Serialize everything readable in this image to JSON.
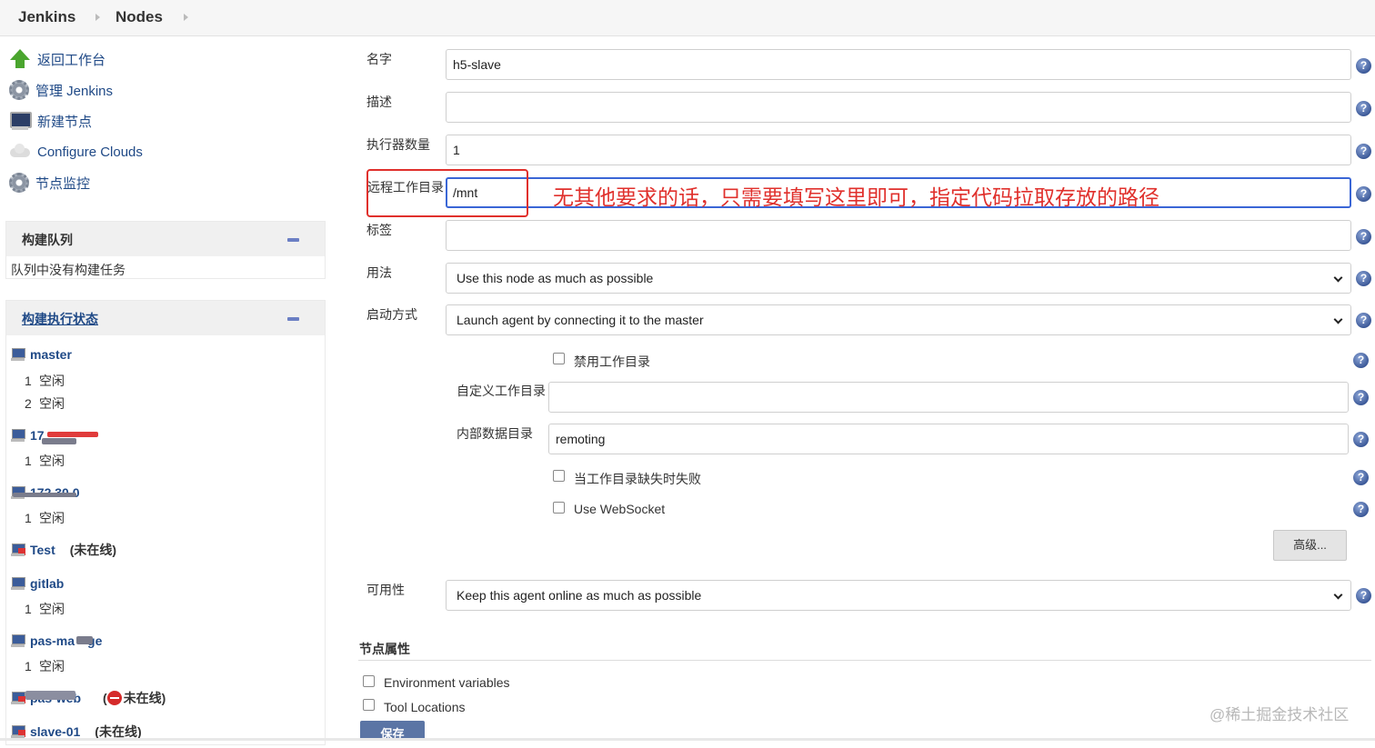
{
  "breadcrumb": {
    "jenkins": "Jenkins",
    "nodes": "Nodes"
  },
  "sidebar": {
    "tasks": [
      {
        "label": "返回工作台",
        "icon": "up-arrow-icon"
      },
      {
        "label": "管理 Jenkins",
        "icon": "gear-icon"
      },
      {
        "label": "新建节点",
        "icon": "computer-icon"
      },
      {
        "label": "Configure Clouds",
        "icon": "cloud-icon"
      },
      {
        "label": "节点监控",
        "icon": "gear-icon"
      }
    ],
    "build_queue": {
      "title": "构建队列",
      "empty_text": "队列中没有构建任务"
    },
    "executor_status": {
      "title": "构建执行状态",
      "idle": "空闲",
      "nodes": [
        {
          "name": "master",
          "executors": [
            "1",
            "2"
          ]
        },
        {
          "name": "17",
          "executors": [
            "1"
          ]
        },
        {
          "name": "172.30.0",
          "executors": [
            "1"
          ]
        },
        {
          "name": "Test",
          "status": "(未在线)"
        },
        {
          "name": "gitlab",
          "executors": [
            "1"
          ]
        },
        {
          "name": "pas-ma",
          "name_tail": "ge",
          "executors": [
            "1"
          ]
        },
        {
          "name": "pas-web",
          "status": "未在线)",
          "status_open": "("
        },
        {
          "name": "slave-01",
          "status": "(未在线)"
        }
      ]
    }
  },
  "form": {
    "name": {
      "label": "名字",
      "value": "h5-slave"
    },
    "description": {
      "label": "描述",
      "value": ""
    },
    "executors": {
      "label": "执行器数量",
      "value": "1"
    },
    "remote_root": {
      "label": "远程工作目录",
      "value": "/mnt"
    },
    "labels": {
      "label": "标签",
      "value": ""
    },
    "usage": {
      "label": "用法",
      "value": "Use this node as much as possible"
    },
    "launch": {
      "label": "启动方式",
      "value": "Launch agent by connecting it to the master"
    },
    "disable_workdir": {
      "label": "禁用工作目录"
    },
    "custom_workdir": {
      "label": "自定义工作目录",
      "value": ""
    },
    "internal_dir": {
      "label": "内部数据目录",
      "value": "remoting"
    },
    "fail_if_missing": {
      "label": "当工作目录缺失时失败"
    },
    "websocket": {
      "label": "Use WebSocket"
    },
    "advanced_button": "高级...",
    "availability": {
      "label": "可用性",
      "value": "Keep this agent online as much as possible"
    },
    "node_properties": {
      "title": "节点属性",
      "env_vars": "Environment variables",
      "tool_locations": "Tool Locations"
    },
    "save_button": "保存",
    "help_glyph": "?"
  },
  "annotation": {
    "text": "无其他要求的话，只需要填写这里即可，指定代码拉取存放的路径"
  },
  "watermark": "@稀土掘金技术社区",
  "colors": {
    "link": "#204a87",
    "annotation": "#e0302c",
    "save": "#5b75a5",
    "help": "#3d5a99"
  }
}
